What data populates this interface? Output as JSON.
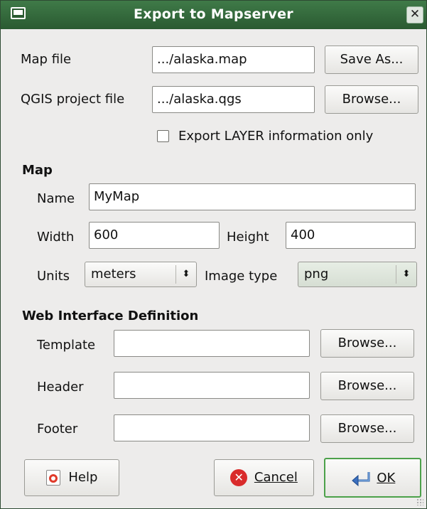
{
  "window": {
    "title": "Export to Mapserver"
  },
  "files": {
    "map_file_label": "Map file",
    "map_file_value": ".../alaska.map",
    "save_as_label": "Save As...",
    "qgis_project_label": "QGIS project file",
    "qgis_project_value": ".../alaska.qgs",
    "browse_label": "Browse...",
    "export_layer_only_label": "Export LAYER information only",
    "export_layer_only_checked": false
  },
  "map": {
    "section_label": "Map",
    "name_label": "Name",
    "name_value": "MyMap",
    "width_label": "Width",
    "width_value": "600",
    "height_label": "Height",
    "height_value": "400",
    "units_label": "Units",
    "units_value": "meters",
    "image_type_label": "Image type",
    "image_type_value": "png"
  },
  "web": {
    "section_label": "Web Interface Definition",
    "template_label": "Template",
    "template_value": "",
    "header_label": "Header",
    "header_value": "",
    "footer_label": "Footer",
    "footer_value": "",
    "browse_label": "Browse..."
  },
  "buttons": {
    "help_label": "Help",
    "cancel_label": "Cancel",
    "ok_label": "OK"
  },
  "icons": {
    "window": "window-icon",
    "close": "close-icon",
    "help": "help-icon",
    "cancel": "cancel-icon",
    "ok": "ok-icon",
    "combo_arrow": "up-down-arrow-icon"
  },
  "colors": {
    "titlebar": "#2f6437",
    "dialog_bg": "#edeceb",
    "ok_border": "#4ca14a",
    "cancel_icon": "#d92b2b"
  }
}
